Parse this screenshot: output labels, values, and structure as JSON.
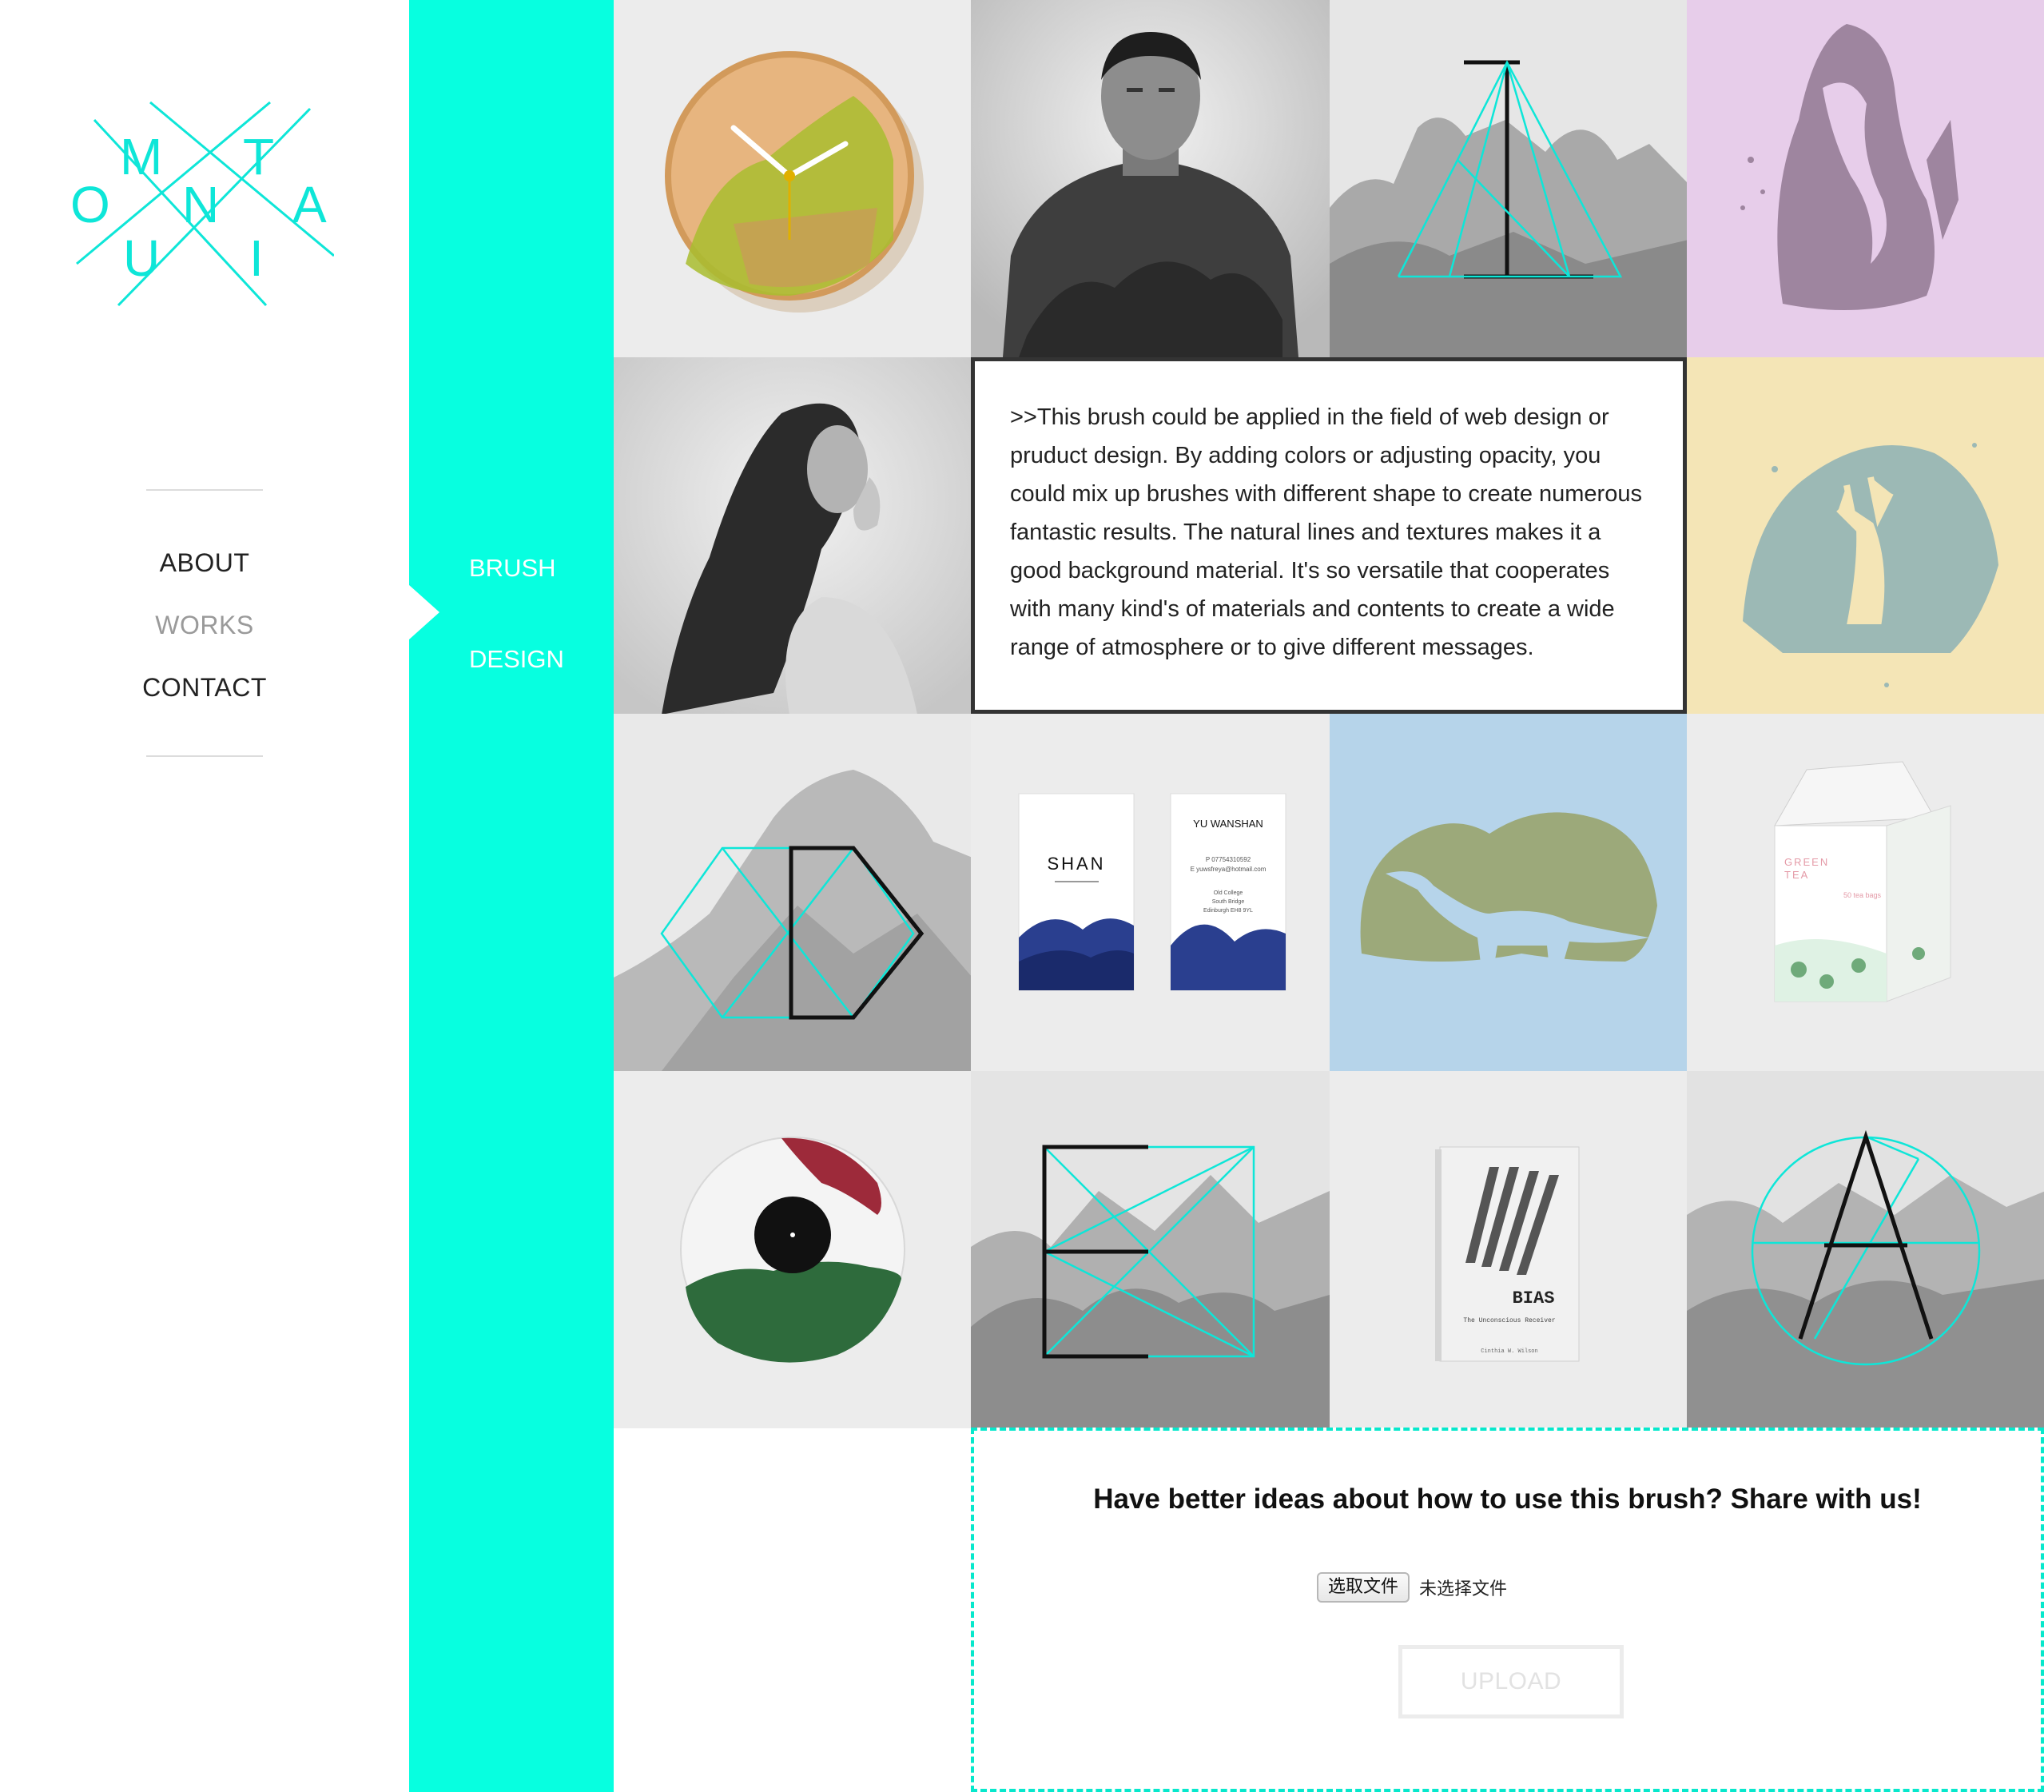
{
  "logo": {
    "letters": [
      "M",
      "T",
      "O",
      "N",
      "A",
      "U",
      "I"
    ]
  },
  "nav": {
    "about": "ABOUT",
    "works": "WORKS",
    "contact": "CONTACT"
  },
  "subnav": {
    "brush": "BRUSH",
    "design": "DESIGN"
  },
  "gallery": {
    "business_card": {
      "front_name": "SHAN",
      "back_name": "YU WANSHAN",
      "phone": "P 07754310592",
      "email": "E yuwsfreya@hotmail.com",
      "address_1": "Old College",
      "address_2": "South Bridge",
      "address_3": "Edinburgh EH8 9YL"
    },
    "milk_carton": {
      "line_1": "GREEN",
      "line_2": "TEA",
      "count": "50 tea bags"
    },
    "book": {
      "title": "BIAS",
      "subtitle": "The Unconscious Receiver",
      "author": "Cinthia W. Wilson"
    }
  },
  "description": ">>This brush could be applied in the field of web design or pruduct design. By adding colors or adjusting opacity, you could mix up brushes with different shape to create numerous fantastic results. The natural lines and textures makes it a good background material. It's so versatile that cooperates with many kind's of materials and contents to create a wide range of atmosphere or to give different messages.",
  "upload": {
    "heading": "Have better ideas about how to use this brush? Share with us!",
    "choose_file": "选取文件",
    "no_file": "未选择文件",
    "upload_button": "UPLOAD"
  },
  "colors": {
    "accent": "#07ffe0",
    "line": "#0ee6d8",
    "border": "#333333"
  }
}
